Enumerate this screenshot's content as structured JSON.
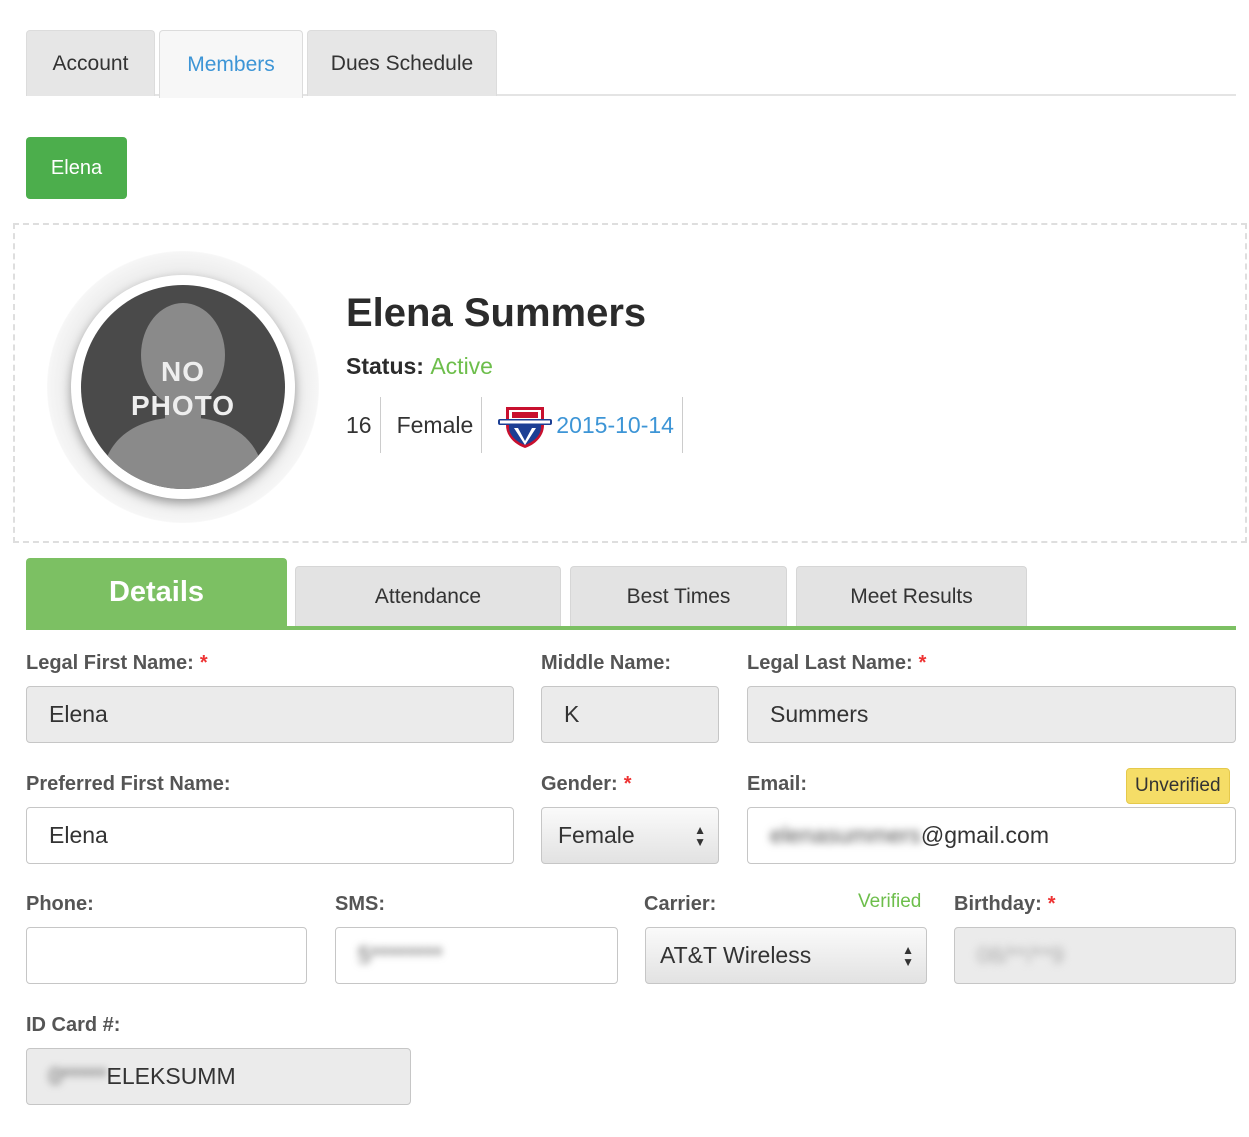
{
  "top_tabs": [
    {
      "label": "Account"
    },
    {
      "label": "Members"
    },
    {
      "label": "Dues Schedule"
    }
  ],
  "member_chip": "Elena",
  "profile": {
    "photo_text_1": "NO",
    "photo_text_2": "PHOTO",
    "name": "Elena Summers",
    "status_label": "Status:",
    "status_value": "Active",
    "age": "16",
    "gender": "Female",
    "usa_date": "2015-10-14"
  },
  "detail_tabs": [
    {
      "label": "Details"
    },
    {
      "label": "Attendance"
    },
    {
      "label": "Best Times"
    },
    {
      "label": "Meet Results"
    }
  ],
  "form": {
    "legal_first_label": "Legal First Name:",
    "legal_first_value": "Elena",
    "middle_label": "Middle Name:",
    "middle_value": "K",
    "legal_last_label": "Legal Last Name:",
    "legal_last_value": "Summers",
    "preferred_label": "Preferred First Name:",
    "preferred_value": "Elena",
    "gender_label": "Gender:",
    "gender_value": "Female",
    "email_label": "Email:",
    "email_badge": "Unverified",
    "email_hidden": "elenasummers",
    "email_domain": "@gmail.com",
    "phone_label": "Phone:",
    "phone_value": "",
    "sms_label": "SMS:",
    "sms_hidden": "5********",
    "carrier_label": "Carrier:",
    "carrier_status": "Verified",
    "carrier_value": "AT&T Wireless",
    "birthday_label": "Birthday:",
    "birthday_hidden": "08/**/**9",
    "id_card_label": "ID Card #:",
    "id_card_hidden": "0*****",
    "id_card_suffix": "ELEKSUMM",
    "required_mark": "*"
  },
  "colors": {
    "accent_green": "#7cc063",
    "chip_green": "#4cae4c",
    "link_blue": "#3d95d6",
    "badge_yellow": "#f5dd67",
    "required_red": "#ee3333"
  }
}
